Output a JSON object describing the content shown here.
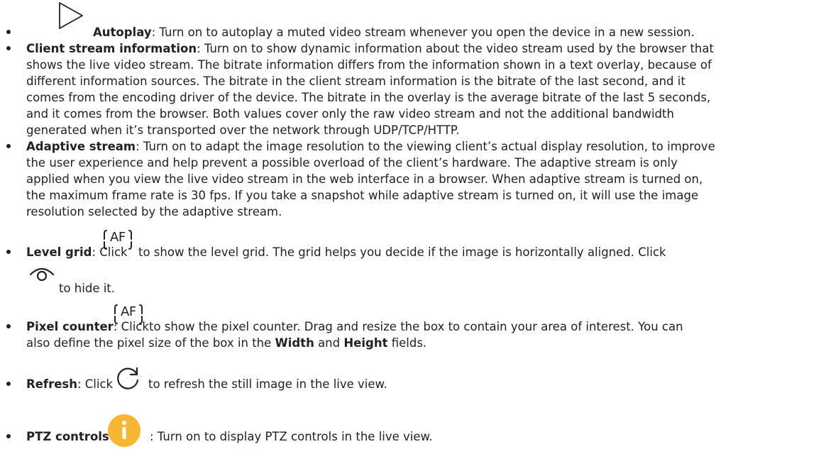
{
  "items": [
    {
      "title": "Autoplay",
      "lines": [
        ": Turn on to autoplay a muted video stream whenever you open the device in a new session."
      ],
      "icon": "play-icon"
    },
    {
      "title": "Client stream information",
      "lines": [
        ": Turn on to show dynamic information about the video stream used by the browser that",
        "shows the live video stream. The bitrate information differs from the information shown in a text overlay, because of",
        "different information sources. The bitrate in the client stream information is the bitrate of the last second, and it",
        "comes from the encoding driver of the device. The bitrate in the overlay is the average bitrate of the last 5 seconds,",
        "and it comes from the browser. Both values cover only the raw video stream and not the additional bandwidth",
        "generated when it’s transported over the network through UDP/TCP/HTTP."
      ]
    },
    {
      "title": "Adaptive stream",
      "lines": [
        ": Turn on to adapt the image resolution to the viewing client’s actual display resolution, to improve",
        "the user experience and help prevent a possible overload of the client’s hardware. The adaptive stream is only",
        "applied when you view the live video stream in the web interface in a browser. When adaptive stream is turned on,",
        "the maximum frame rate is 30 fps. If you take a snapshot while adaptive stream is turned on, it will use the image",
        "resolution selected by the adaptive stream."
      ]
    },
    {
      "title": "Level grid",
      "pre_icon_text": ": Click",
      "post_icon_text": "to show the level grid. The grid helps you decide if the image is horizontally aligned. Click",
      "hide_text": "to hide it.",
      "icons": [
        "af-icon",
        "eye-off-icon"
      ]
    },
    {
      "title": "Pixel counter",
      "pre_icon_text": ": Click",
      "post_icon_text": "to show the pixel counter. Drag and resize the box to contain your area of interest. You can",
      "line2_pre": "also define the pixel size of the box in the ",
      "width_label": "Width",
      "line2_mid": " and ",
      "height_label": "Height",
      "line2_post": " fields.",
      "icon": "af-icon"
    },
    {
      "title": "Refresh",
      "pre_icon_text": ": Click",
      "post_icon_text": "to refresh the still image in the live view.",
      "icon": "refresh-icon"
    },
    {
      "title": "PTZ controls",
      "post_icon_text": ": Turn on to display PTZ controls in the live view.",
      "icon": "info-icon",
      "icon_color": "#f7b733"
    }
  ],
  "af_glyph": "AF"
}
